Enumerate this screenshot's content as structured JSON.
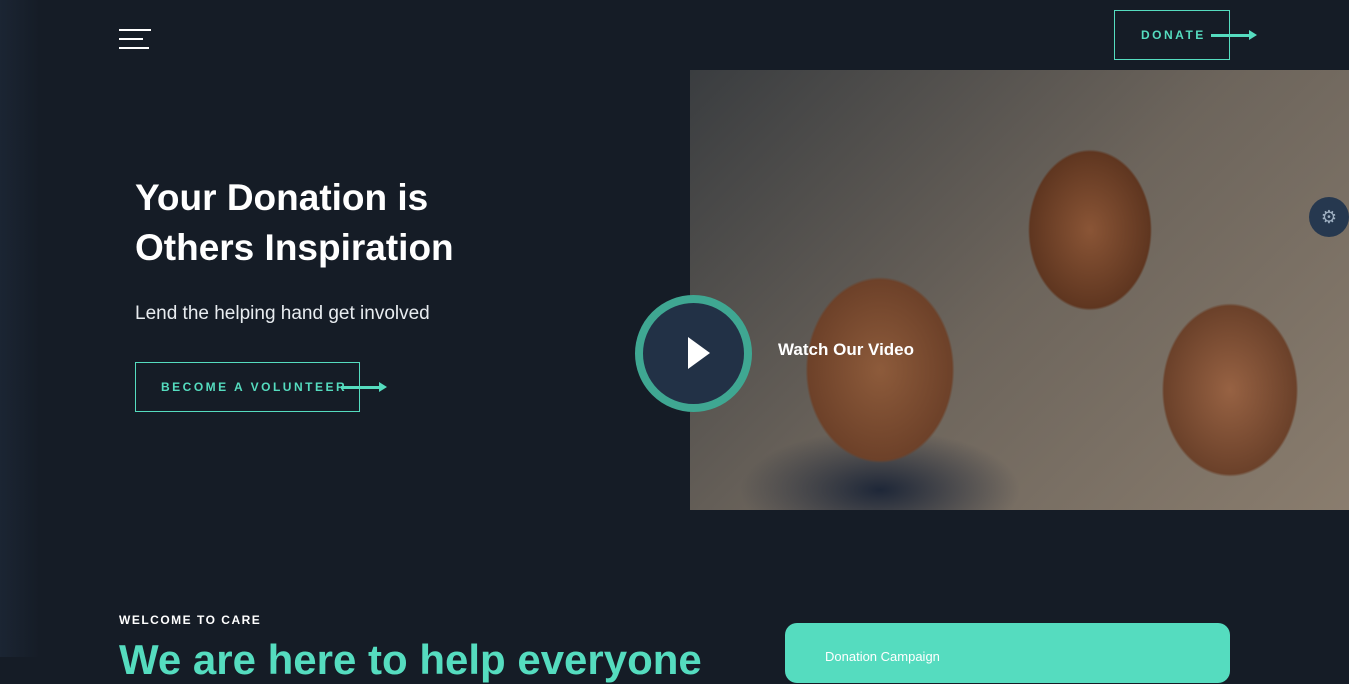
{
  "header": {
    "donate_label": "DONATE"
  },
  "hero": {
    "title": "Your Donation is Others Inspiration",
    "subtitle": "Lend the helping hand get involved",
    "volunteer_label": "BECOME A VOLUNTEER",
    "video_label": "Watch Our Video"
  },
  "about": {
    "eyebrow": "WELCOME TO CARE",
    "title": "We are here to help everyone",
    "card_label": "Donation Campaign"
  },
  "colors": {
    "accent": "#55dcbf",
    "background": "#151c26"
  },
  "icons": {
    "menu": "hamburger-icon",
    "play": "play-icon",
    "settings": "gear-icon",
    "arrow": "arrow-right-icon"
  }
}
